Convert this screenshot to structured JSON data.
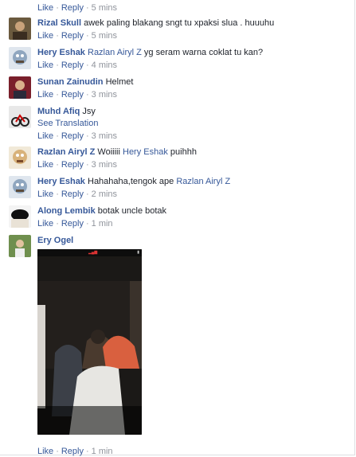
{
  "actions": {
    "like": "Like",
    "reply": "Reply"
  },
  "top_time": "5 mins",
  "comments": [
    {
      "name": "Rizal Skull",
      "text": "awek paling blakang sngt tu xpaksi slua . huuuhu",
      "time": "5 mins"
    },
    {
      "name": "Hery Eshak",
      "mention": "Razlan Airyl Z",
      "text": "yg seram warna coklat tu kan?",
      "time": "4 mins"
    },
    {
      "name": "Sunan Zainudin",
      "text": "Helmet",
      "time": "3 mins"
    },
    {
      "name": "Muhd Afiq",
      "text": "Jsy",
      "see_translation": "See Translation",
      "time": "3 mins"
    },
    {
      "name": "Razlan Airyl Z",
      "text": "Woiiiii",
      "mention": "Hery Eshak",
      "text2": "puihhh",
      "time": "3 mins"
    },
    {
      "name": "Hery Eshak",
      "text": "Hahahaha,tengok ape",
      "mention": "Razlan Airyl Z",
      "time": "2 mins"
    },
    {
      "name": "Along Lembik",
      "text": "botak uncle botak",
      "time": "1 min"
    },
    {
      "name": "Ery Ogel",
      "time": "1 min"
    }
  ],
  "colors": {
    "link": "#365899",
    "meta": "#90949c",
    "text": "#1d2129"
  }
}
